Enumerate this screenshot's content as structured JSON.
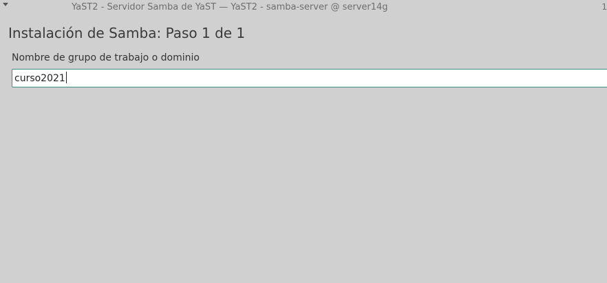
{
  "window": {
    "title": "YaST2 - Servidor Samba de YaST — YaST2 - samba-server @ server14g",
    "corner_glyph": "1"
  },
  "wizard": {
    "heading": "Instalación de Samba: Paso 1 de 1",
    "workgroup_label_pre": "Nombre de ",
    "workgroup_label_mnemonic": "g",
    "workgroup_label_post": "rupo de trabajo o dominio",
    "workgroup_value": "curso2021"
  }
}
